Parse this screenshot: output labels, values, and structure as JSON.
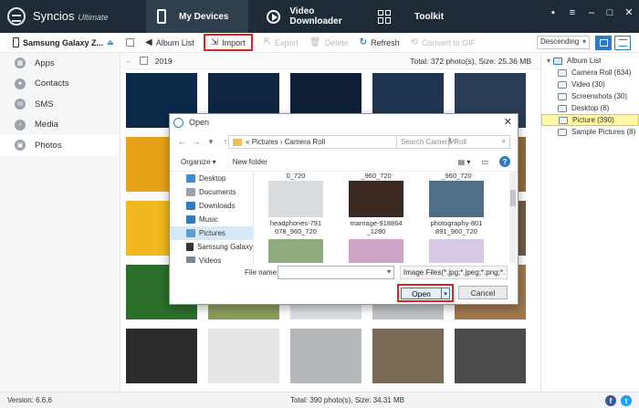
{
  "app": {
    "name": "Syncios",
    "edition": "Ultimate",
    "tabs": [
      {
        "label": "My Devices",
        "active": true,
        "icon": "phone-icon"
      },
      {
        "label": "Video Downloader",
        "active": false,
        "icon": "play-icon"
      },
      {
        "label": "Toolkit",
        "active": false,
        "icon": "grid-icon"
      }
    ],
    "window_controls": [
      {
        "icon": "message-icon",
        "glyph": "▪"
      },
      {
        "icon": "menu-icon",
        "glyph": "≡"
      },
      {
        "icon": "minimize-icon",
        "glyph": "–"
      },
      {
        "icon": "maximize-icon",
        "glyph": "□"
      },
      {
        "icon": "close-icon",
        "glyph": "✕"
      }
    ]
  },
  "device": {
    "name": "Samsung Galaxy Z..."
  },
  "sidebar": {
    "items": [
      {
        "label": "Apps",
        "icon": "apps-icon",
        "active": false
      },
      {
        "label": "Contacts",
        "icon": "contacts-icon",
        "active": false
      },
      {
        "label": "SMS",
        "icon": "sms-icon",
        "active": false
      },
      {
        "label": "Media",
        "icon": "media-icon",
        "active": false
      },
      {
        "label": "Photos",
        "icon": "photos-icon",
        "active": true
      }
    ]
  },
  "toolbar": {
    "album_list": "Album List",
    "import": "Import",
    "export": "Export",
    "delete": "Delete",
    "refresh": "Refresh",
    "convert_gif": "Convert to GIF",
    "sort": "Descending"
  },
  "photos": {
    "year": "2019",
    "total": "Total: 372 photo(s), Size: 25.36 MB",
    "tile_colors": [
      [
        "#0b2a4a",
        "#102640",
        "#0e1e35",
        "#1f3550",
        "#2a3d55"
      ],
      [
        "#e7a21a",
        "#6b7d8f",
        "#b98a5c",
        "#cfd7dc",
        "#8f6a3a"
      ],
      [
        "#f0b91f",
        "#3a4a58",
        "#c9a06a",
        "#dcd6c9",
        "#6d5a44"
      ],
      [
        "#2c6f2a",
        "#8a9e5a",
        "#d9dee2",
        "#bfc3c6",
        "#a0774d"
      ],
      [
        "#2a2a2a",
        "#e3e5e7",
        "#b5b9bb",
        "#7a6a55",
        "#4b4b4b"
      ]
    ]
  },
  "albums": {
    "root": "Album List",
    "items": [
      {
        "label": "Camera Roll (634)",
        "selected": false
      },
      {
        "label": "Video (30)",
        "selected": false
      },
      {
        "label": "Screenshots (30)",
        "selected": false
      },
      {
        "label": "Desktop (8)",
        "selected": false
      },
      {
        "label": "Picture (390)",
        "selected": true
      },
      {
        "label": "Sample Pictures (8)",
        "selected": false
      }
    ]
  },
  "status": {
    "version": "Version: 6.6.6",
    "total": "Total: 390 photo(s), Size: 34.31 MB"
  },
  "dialog": {
    "title": "Open",
    "path": [
      "«",
      "Pictures",
      "›",
      "Camera Roll"
    ],
    "search_placeholder": "Search Camera Roll",
    "organize": "Organize ▾",
    "new_folder": "New folder",
    "nav_items": [
      {
        "label": "Desktop",
        "icon": "desktop-icon",
        "color": "#3a8fd8",
        "selected": false
      },
      {
        "label": "Documents",
        "icon": "documents-icon",
        "color": "#9aa3ab",
        "selected": false
      },
      {
        "label": "Downloads",
        "icon": "downloads-icon",
        "color": "#2e7bc4",
        "selected": false
      },
      {
        "label": "Music",
        "icon": "music-icon",
        "color": "#2e7bc4",
        "selected": false
      },
      {
        "label": "Pictures",
        "icon": "pictures-icon",
        "color": "#5aa0d8",
        "selected": true
      },
      {
        "label": "Samsung Galaxy",
        "icon": "phone-icon",
        "color": "#333333",
        "selected": false
      },
      {
        "label": "Videos",
        "icon": "videos-icon",
        "color": "#7a8894",
        "selected": false
      }
    ],
    "files": [
      {
        "top_label": "0_720",
        "name": [
          "headphones-791",
          "078_960_720"
        ],
        "color": "#d9dcdf"
      },
      {
        "top_label": "_960_720",
        "name": [
          "marriage-918864",
          "_1280"
        ],
        "color": "#3a2a22"
      },
      {
        "top_label": "_960_720",
        "name": [
          "photography-801",
          "891_960_720"
        ],
        "color": "#4f6f86"
      }
    ],
    "row2_colors": [
      "#8faa7e",
      "#cfa6c6",
      "#d7c8e5"
    ],
    "file_name_label": "File name:",
    "file_type": "Image Files(*.jpg;*.jpeg;*.png;*.",
    "open_label": "Open",
    "cancel_label": "Cancel"
  }
}
